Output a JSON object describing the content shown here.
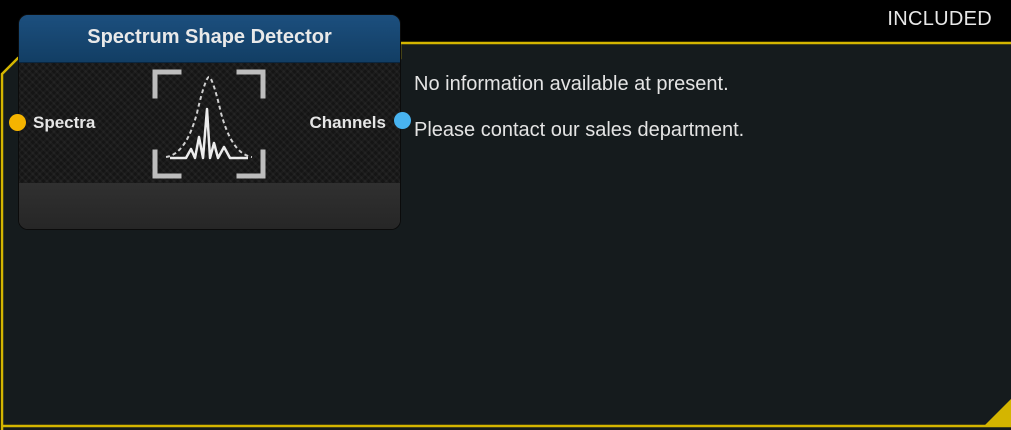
{
  "badge": "INCLUDED",
  "node": {
    "title": "Spectrum Shape Detector",
    "input_port": "Spectra",
    "output_port": "Channels",
    "icon": "spectrum-peak-icon"
  },
  "info": {
    "line1": "No information available at present.",
    "line2": "Please contact our sales department."
  },
  "colors": {
    "frame_border": "#d4b500",
    "panel_bg": "#151b1d",
    "header_blue": "#184a76",
    "input_port": "#f5b400",
    "output_port": "#48b3f0"
  }
}
